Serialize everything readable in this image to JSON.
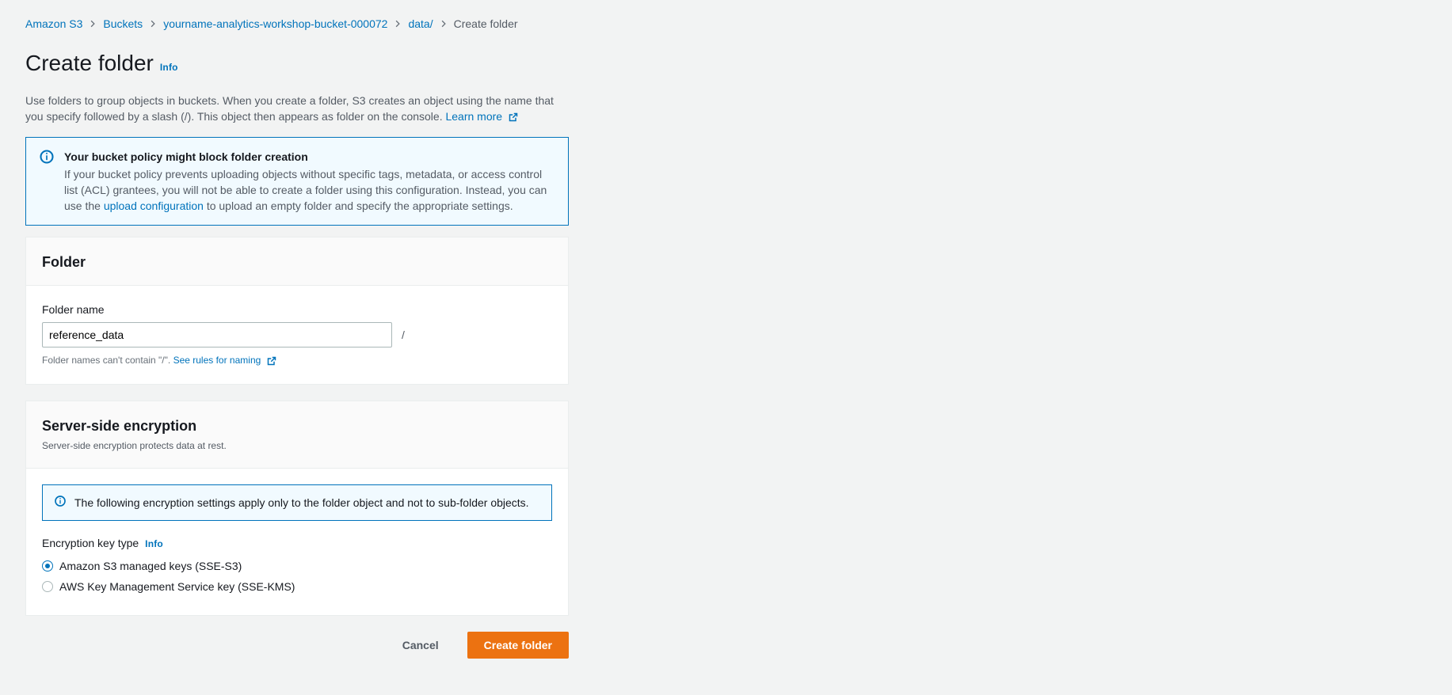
{
  "breadcrumbs": {
    "items": [
      {
        "label": "Amazon S3"
      },
      {
        "label": "Buckets"
      },
      {
        "label": "yourname-analytics-workshop-bucket-000072"
      },
      {
        "label": "data/"
      }
    ],
    "current": "Create folder"
  },
  "header": {
    "title": "Create folder",
    "info": "Info",
    "description_pre": "Use folders to group objects in buckets. When you create a folder, S3 creates an object using the name that you specify followed by a slash (/). This object then appears as folder on the console. ",
    "learn_more": "Learn more"
  },
  "alert_policy": {
    "title": "Your bucket policy might block folder creation",
    "body_pre": "If your bucket policy prevents uploading objects without specific tags, metadata, or access control list (ACL) grantees, you will not be able to create a folder using this configuration. Instead, you can use the ",
    "link": "upload configuration",
    "body_post": " to upload an empty folder and specify the appropriate settings."
  },
  "folder_panel": {
    "heading": "Folder",
    "label": "Folder name",
    "value": "reference_data",
    "slash": "/",
    "hint_pre": "Folder names can't contain \"/\". ",
    "hint_link": "See rules for naming"
  },
  "encryption_panel": {
    "heading": "Server-side encryption",
    "subheading": "Server-side encryption protects data at rest.",
    "inner_alert": "The following encryption settings apply only to the folder object and not to sub-folder objects.",
    "key_type_label": "Encryption key type",
    "key_type_info": "Info",
    "options": [
      {
        "label": "Amazon S3 managed keys (SSE-S3)",
        "selected": true
      },
      {
        "label": "AWS Key Management Service key (SSE-KMS)",
        "selected": false
      }
    ]
  },
  "footer": {
    "cancel": "Cancel",
    "submit": "Create folder"
  }
}
